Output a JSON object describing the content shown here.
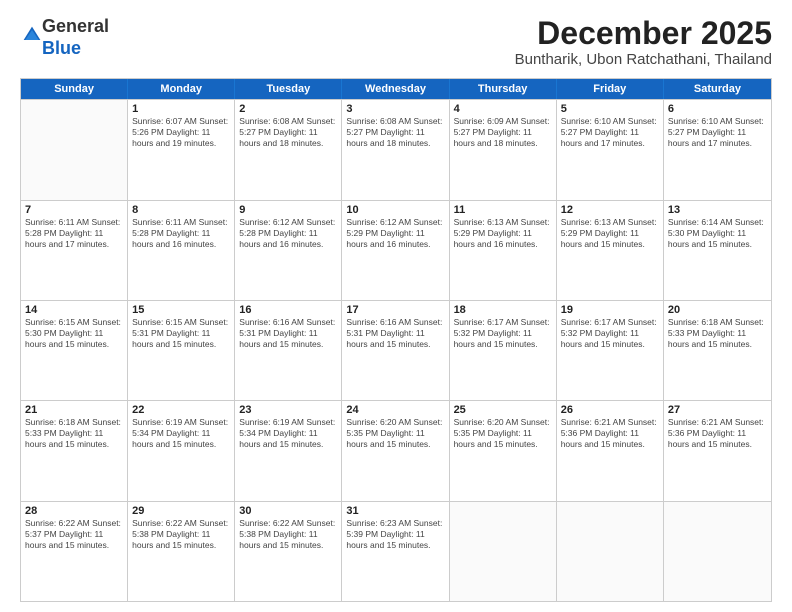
{
  "logo": {
    "general": "General",
    "blue": "Blue"
  },
  "header": {
    "month": "December 2025",
    "location": "Buntharik, Ubon Ratchathani, Thailand"
  },
  "weekdays": [
    "Sunday",
    "Monday",
    "Tuesday",
    "Wednesday",
    "Thursday",
    "Friday",
    "Saturday"
  ],
  "weeks": [
    [
      {
        "day": "",
        "info": ""
      },
      {
        "day": "1",
        "info": "Sunrise: 6:07 AM\nSunset: 5:26 PM\nDaylight: 11 hours\nand 19 minutes."
      },
      {
        "day": "2",
        "info": "Sunrise: 6:08 AM\nSunset: 5:27 PM\nDaylight: 11 hours\nand 18 minutes."
      },
      {
        "day": "3",
        "info": "Sunrise: 6:08 AM\nSunset: 5:27 PM\nDaylight: 11 hours\nand 18 minutes."
      },
      {
        "day": "4",
        "info": "Sunrise: 6:09 AM\nSunset: 5:27 PM\nDaylight: 11 hours\nand 18 minutes."
      },
      {
        "day": "5",
        "info": "Sunrise: 6:10 AM\nSunset: 5:27 PM\nDaylight: 11 hours\nand 17 minutes."
      },
      {
        "day": "6",
        "info": "Sunrise: 6:10 AM\nSunset: 5:27 PM\nDaylight: 11 hours\nand 17 minutes."
      }
    ],
    [
      {
        "day": "7",
        "info": "Sunrise: 6:11 AM\nSunset: 5:28 PM\nDaylight: 11 hours\nand 17 minutes."
      },
      {
        "day": "8",
        "info": "Sunrise: 6:11 AM\nSunset: 5:28 PM\nDaylight: 11 hours\nand 16 minutes."
      },
      {
        "day": "9",
        "info": "Sunrise: 6:12 AM\nSunset: 5:28 PM\nDaylight: 11 hours\nand 16 minutes."
      },
      {
        "day": "10",
        "info": "Sunrise: 6:12 AM\nSunset: 5:29 PM\nDaylight: 11 hours\nand 16 minutes."
      },
      {
        "day": "11",
        "info": "Sunrise: 6:13 AM\nSunset: 5:29 PM\nDaylight: 11 hours\nand 16 minutes."
      },
      {
        "day": "12",
        "info": "Sunrise: 6:13 AM\nSunset: 5:29 PM\nDaylight: 11 hours\nand 15 minutes."
      },
      {
        "day": "13",
        "info": "Sunrise: 6:14 AM\nSunset: 5:30 PM\nDaylight: 11 hours\nand 15 minutes."
      }
    ],
    [
      {
        "day": "14",
        "info": "Sunrise: 6:15 AM\nSunset: 5:30 PM\nDaylight: 11 hours\nand 15 minutes."
      },
      {
        "day": "15",
        "info": "Sunrise: 6:15 AM\nSunset: 5:31 PM\nDaylight: 11 hours\nand 15 minutes."
      },
      {
        "day": "16",
        "info": "Sunrise: 6:16 AM\nSunset: 5:31 PM\nDaylight: 11 hours\nand 15 minutes."
      },
      {
        "day": "17",
        "info": "Sunrise: 6:16 AM\nSunset: 5:31 PM\nDaylight: 11 hours\nand 15 minutes."
      },
      {
        "day": "18",
        "info": "Sunrise: 6:17 AM\nSunset: 5:32 PM\nDaylight: 11 hours\nand 15 minutes."
      },
      {
        "day": "19",
        "info": "Sunrise: 6:17 AM\nSunset: 5:32 PM\nDaylight: 11 hours\nand 15 minutes."
      },
      {
        "day": "20",
        "info": "Sunrise: 6:18 AM\nSunset: 5:33 PM\nDaylight: 11 hours\nand 15 minutes."
      }
    ],
    [
      {
        "day": "21",
        "info": "Sunrise: 6:18 AM\nSunset: 5:33 PM\nDaylight: 11 hours\nand 15 minutes."
      },
      {
        "day": "22",
        "info": "Sunrise: 6:19 AM\nSunset: 5:34 PM\nDaylight: 11 hours\nand 15 minutes."
      },
      {
        "day": "23",
        "info": "Sunrise: 6:19 AM\nSunset: 5:34 PM\nDaylight: 11 hours\nand 15 minutes."
      },
      {
        "day": "24",
        "info": "Sunrise: 6:20 AM\nSunset: 5:35 PM\nDaylight: 11 hours\nand 15 minutes."
      },
      {
        "day": "25",
        "info": "Sunrise: 6:20 AM\nSunset: 5:35 PM\nDaylight: 11 hours\nand 15 minutes."
      },
      {
        "day": "26",
        "info": "Sunrise: 6:21 AM\nSunset: 5:36 PM\nDaylight: 11 hours\nand 15 minutes."
      },
      {
        "day": "27",
        "info": "Sunrise: 6:21 AM\nSunset: 5:36 PM\nDaylight: 11 hours\nand 15 minutes."
      }
    ],
    [
      {
        "day": "28",
        "info": "Sunrise: 6:22 AM\nSunset: 5:37 PM\nDaylight: 11 hours\nand 15 minutes."
      },
      {
        "day": "29",
        "info": "Sunrise: 6:22 AM\nSunset: 5:38 PM\nDaylight: 11 hours\nand 15 minutes."
      },
      {
        "day": "30",
        "info": "Sunrise: 6:22 AM\nSunset: 5:38 PM\nDaylight: 11 hours\nand 15 minutes."
      },
      {
        "day": "31",
        "info": "Sunrise: 6:23 AM\nSunset: 5:39 PM\nDaylight: 11 hours\nand 15 minutes."
      },
      {
        "day": "",
        "info": ""
      },
      {
        "day": "",
        "info": ""
      },
      {
        "day": "",
        "info": ""
      }
    ]
  ]
}
